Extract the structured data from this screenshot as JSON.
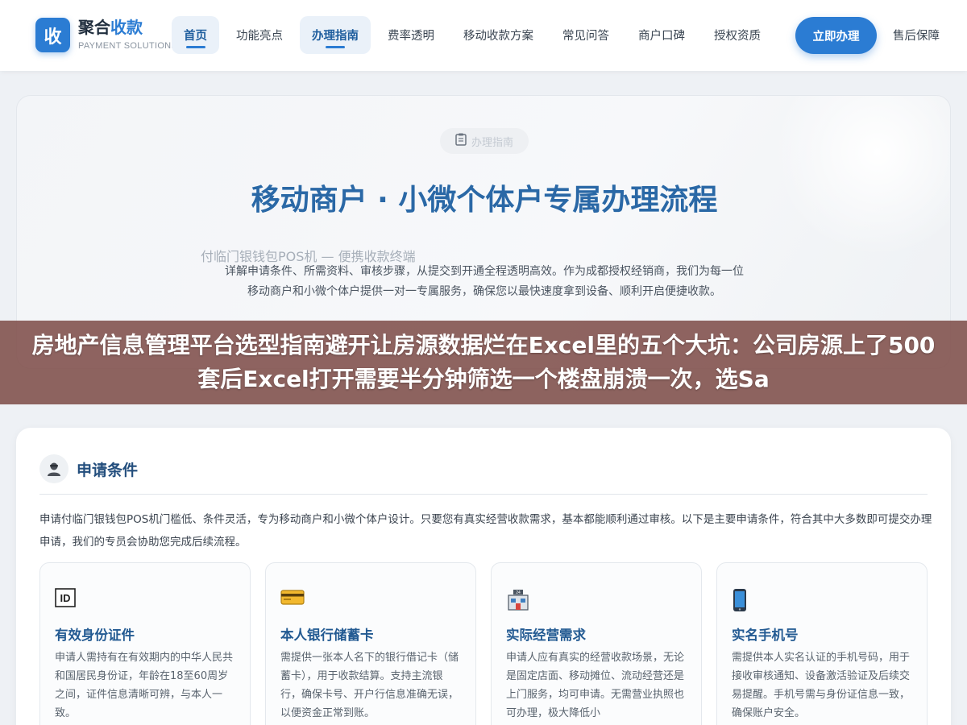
{
  "brand": {
    "mark": "收",
    "name_main": "聚合",
    "name_accent": "收款",
    "subtitle": "PAYMENT SOLUTIONS",
    "color": "#2b7cd3"
  },
  "nav": {
    "items": [
      {
        "label": "首页",
        "active": true
      },
      {
        "label": "功能亮点",
        "active": false
      },
      {
        "label": "办理指南",
        "active": true
      },
      {
        "label": "费率透明",
        "active": false
      },
      {
        "label": "移动收款方案",
        "active": false
      },
      {
        "label": "常见问答",
        "active": false
      },
      {
        "label": "商户口碑",
        "active": false
      },
      {
        "label": "授权资质",
        "active": false
      }
    ],
    "cta_label": "立即办理",
    "after_cta": "售后保障"
  },
  "hero": {
    "badge_icon": "clipboard-icon",
    "badge_label": "办理指南",
    "title": "移动商户 · 小微个体户专属办理流程",
    "product_line": "付临门银钱包POS机 — 便携收款终端",
    "description": "详解申请条件、所需资料、审核步骤，从提交到开通全程透明高效。作为成都授权经销商，我们为每一位移动商户和小微个体户提供一对一专属服务，确保您以最快速度拿到设备、顺利开启便捷收款。"
  },
  "overlay": {
    "text": "房地产信息管理平台选型指南避开让房源数据烂在Excel里的五个大坑：公司房源上了500套后Excel打开需要半分钟筛选一个楼盘崩溃一次，选Sa"
  },
  "conditions": {
    "icon": "person-icon",
    "title": "申请条件",
    "intro": "申请付临门银钱包POS机门槛低、条件灵活，专为移动商户和小微个体户设计。只要您有真实经营收款需求，基本都能顺利通过审核。以下是主要申请条件，符合其中大多数即可提交办理申请，我们的专员会协助您完成后续流程。",
    "cards": [
      {
        "icon": "id-card-icon",
        "title": "有效身份证件",
        "text": "申请人需持有在有效期内的中华人民共和国居民身份证，年龄在18至60周岁之间，证件信息清晰可辨，与本人一致。"
      },
      {
        "icon": "bank-card-icon",
        "title": "本人银行储蓄卡",
        "text": "需提供一张本人名下的银行借记卡（储蓄卡），用于收款结算。支持主流银行，确保卡号、开户行信息准确无误，以便资金正常到账。"
      },
      {
        "icon": "store-icon",
        "title": "实际经营需求",
        "text": "申请人应有真实的经营收款场景，无论是固定店面、移动摊位、流动经营还是上门服务，均可申请。无需营业执照也可办理，极大降低小"
      },
      {
        "icon": "phone-icon",
        "title": "实名手机号",
        "text": "需提供本人实名认证的手机号码，用于接收审核通知、设备激活验证及后续交易提醒。手机号需与身份证信息一致，确保账户安全。"
      }
    ]
  },
  "colors": {
    "primary": "#2b7cd3",
    "title_blue": "#2a68a6",
    "overlay": "#804e4a"
  }
}
